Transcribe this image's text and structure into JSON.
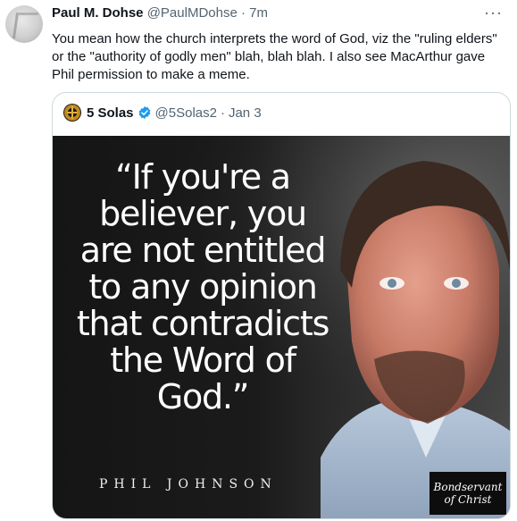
{
  "tweet": {
    "author_name": "Paul M. Dohse",
    "author_handle": "@PaulMDohse",
    "separator": "·",
    "time": "7m",
    "more": "···",
    "text": "You mean how the church interprets the word of God, viz the \"ruling elders\" or the \"authority of godly men\" blah, blah blah. I also see MacArthur gave Phil permission to make a meme."
  },
  "quote": {
    "author_name": "5 Solas",
    "author_handle": "@5Solas2",
    "separator": "·",
    "date": "Jan 3",
    "verified_icon": "verified-badge-icon",
    "image": {
      "quote_text": "“If you're a believer, you are not entitled to any opinion that contradicts the Word of God.”",
      "attribution": "PHIL JOHNSON",
      "logo_line1": "Bondservant",
      "logo_line2": "of Christ"
    }
  },
  "colors": {
    "text_primary": "#0f1419",
    "text_muted": "#536471",
    "border": "#cfd9de",
    "verified": "#1d9bf0"
  }
}
